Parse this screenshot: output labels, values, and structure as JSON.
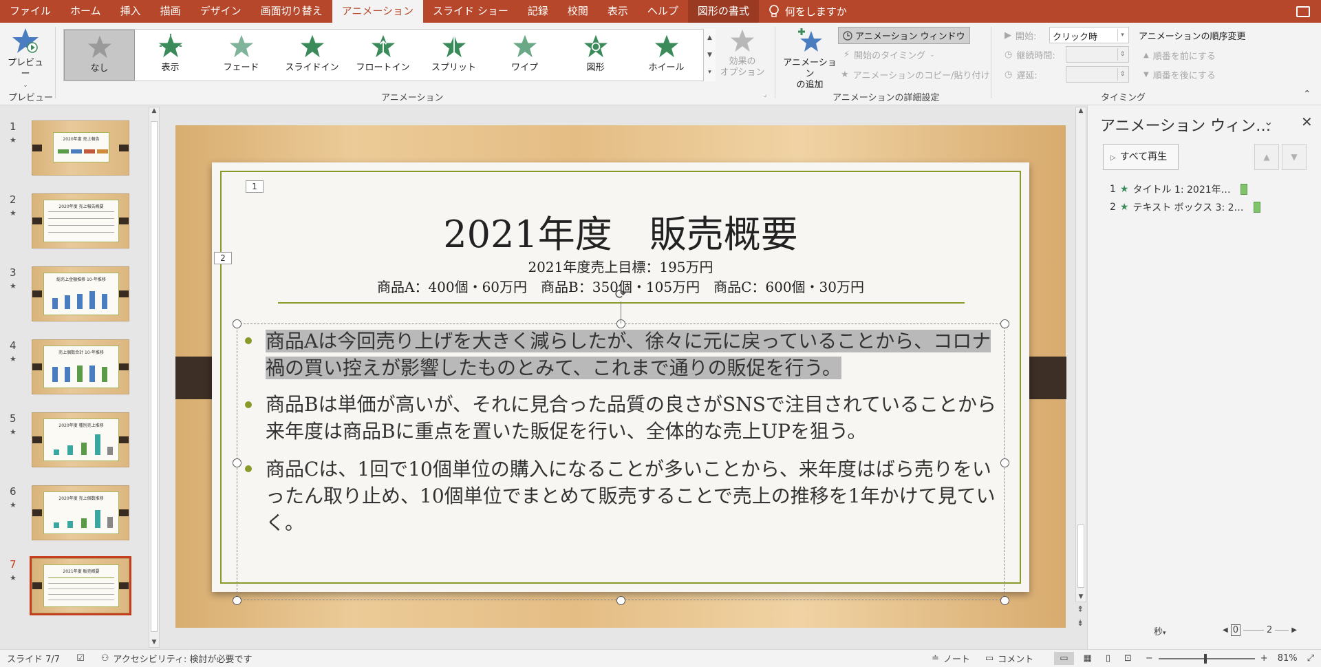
{
  "menubar": {
    "tabs": [
      "ファイル",
      "ホーム",
      "挿入",
      "描画",
      "デザイン",
      "画面切り替え",
      "アニメーション",
      "スライド ショー",
      "記録",
      "校閲",
      "表示",
      "ヘルプ",
      "図形の書式"
    ],
    "active_tab": "アニメーション",
    "tell_me": "何をしますか"
  },
  "ribbon": {
    "preview_label": "プレビュー",
    "preview_group": "プレビュー",
    "animations": [
      "なし",
      "表示",
      "フェード",
      "スライドイン",
      "フロートイン",
      "スプリット",
      "ワイプ",
      "図形",
      "ホイール"
    ],
    "effect_options": "効果の\nオプション",
    "animation_group": "アニメーション",
    "add_animation": "アニメーション\nの追加",
    "animation_pane": "アニメーション ウィンドウ",
    "trigger": "開始のタイミング",
    "painter": "アニメーションのコピー/貼り付け",
    "advanced_group": "アニメーションの詳細設定",
    "start_label": "開始:",
    "start_value": "クリック時",
    "duration_label": "継続時間:",
    "delay_label": "遅延:",
    "reorder_title": "アニメーションの順序変更",
    "move_earlier": "順番を前にする",
    "move_later": "順番を後にする",
    "timing_group": "タイミング"
  },
  "thumbnails": [
    {
      "num": "1",
      "title": "2020年度 売上報告"
    },
    {
      "num": "2",
      "title": "2020年度 売上報告概要"
    },
    {
      "num": "3",
      "title": "総売上金額推移 10-年推移"
    },
    {
      "num": "4",
      "title": "売上個数合計 10-年推移"
    },
    {
      "num": "5",
      "title": "2020年度 種別売上推移"
    },
    {
      "num": "6",
      "title": "2020年度 売上個数推移"
    },
    {
      "num": "7",
      "title": "2021年度 販売概要"
    }
  ],
  "slide": {
    "tag1": "1",
    "tag2": "2",
    "title": "2021年度　販売概要",
    "subtitle1": "2021年度売上目標：195万円",
    "subtitle2": "商品A：400個・60万円　商品B：350個・105万円　商品C：600個・30万円",
    "bullets": [
      "商品Aは今回売り上げを大きく減らしたが、徐々に元に戻っていることから、コロナ禍の買い控えが影響したものとみて、これまで通りの販促を行う。",
      "商品Bは単価が高いが、それに見合った品質の良さがSNSで注目されていることから来年度は商品Bに重点を置いた販促を行い、全体的な売上UPを狙う。",
      "商品Cは、1回で10個単位の購入になることが多いことから、来年度はばら売りをいったん取り止め、10個単位でまとめて販売することで売上の推移を1年かけて見ていく。"
    ]
  },
  "anim_pane": {
    "title": "アニメーション ウィン…",
    "play_all": "すべて再生",
    "items": [
      {
        "num": "1",
        "label": "タイトル 1: 2021年…"
      },
      {
        "num": "2",
        "label": "テキスト ボックス 3: 2…"
      }
    ],
    "seconds": "秒",
    "scale_left": "0",
    "scale_right": "2"
  },
  "status": {
    "slide_counter": "スライド 7/7",
    "accessibility": "アクセシビリティ: 検討が必要です",
    "notes": "ノート",
    "comments": "コメント",
    "zoom": "81%"
  },
  "colors": {
    "accent": "#b7472a",
    "green_line": "#8a9a2a",
    "star": "#3a8a5a"
  }
}
